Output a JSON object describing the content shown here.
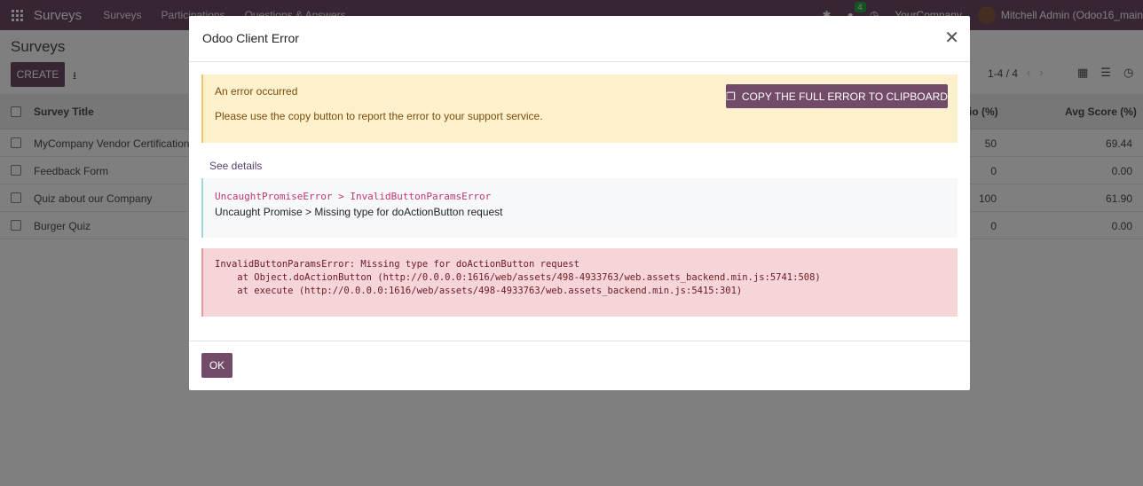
{
  "navbar": {
    "app_name": "Surveys",
    "menus": [
      "Surveys",
      "Participations",
      "Questions & Answers"
    ],
    "chat_count": "4",
    "company": "YourCompany",
    "user": "Mitchell Admin (Odoo16_main"
  },
  "control_panel": {
    "title": "Surveys",
    "create_label": "CREATE",
    "pager": "1-4 / 4"
  },
  "list": {
    "headers": {
      "title": "Survey Title",
      "ratio": "io (%)",
      "avg": "Avg Score (%)"
    },
    "rows": [
      {
        "title": "MyCompany Vendor Certification",
        "ratio": "50",
        "avg": "69.44"
      },
      {
        "title": "Feedback Form",
        "ratio": "0",
        "avg": "0.00"
      },
      {
        "title": "Quiz about our Company",
        "ratio": "100",
        "avg": "61.90"
      },
      {
        "title": "Burger Quiz",
        "ratio": "0",
        "avg": "0.00"
      }
    ]
  },
  "dialog": {
    "title": "Odoo Client Error",
    "alert_heading": "An error occurred",
    "alert_text": "Please use the copy button to report the error to your support service.",
    "copy_label": "COPY THE FULL ERROR TO CLIPBOARD",
    "see_details": "See details",
    "error_name": "UncaughtPromiseError > InvalidButtonParamsError",
    "error_message": "Uncaught Promise > Missing type for doActionButton request",
    "traceback": "InvalidButtonParamsError: Missing type for doActionButton request\n    at Object.doActionButton (http://0.0.0.0:1616/web/assets/498-4933763/web.assets_backend.min.js:5741:508)\n    at execute (http://0.0.0.0:1616/web/assets/498-4933763/web.assets_backend.min.js:5415:301)",
    "ok_label": "OK"
  }
}
